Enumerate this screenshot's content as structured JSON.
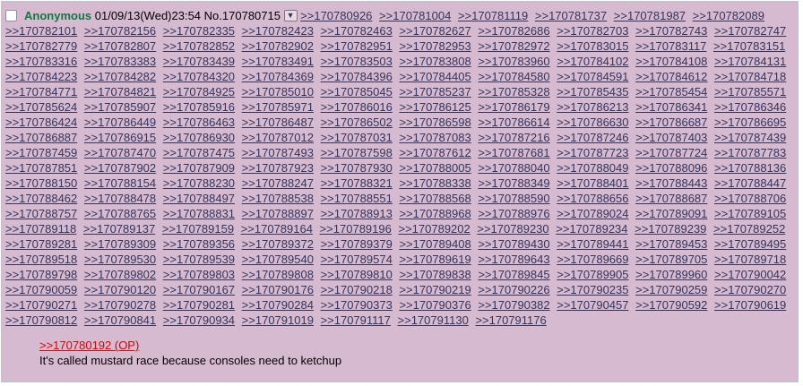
{
  "post": {
    "name": "Anonymous",
    "datetime": "01/09/13(Wed)23:54",
    "number": "No.170780715",
    "menu_glyph": "▼",
    "replies": [
      ">>170780926",
      ">>170781004",
      ">>170781119",
      ">>170781737",
      ">>170781987",
      ">>170782089",
      ">>170782101",
      ">>170782156",
      ">>170782335",
      ">>170782423",
      ">>170782463",
      ">>170782627",
      ">>170782686",
      ">>170782703",
      ">>170782743",
      ">>170782747",
      ">>170782779",
      ">>170782807",
      ">>170782852",
      ">>170782902",
      ">>170782951",
      ">>170782953",
      ">>170782972",
      ">>170783015",
      ">>170783117",
      ">>170783151",
      ">>170783316",
      ">>170783383",
      ">>170783439",
      ">>170783491",
      ">>170783503",
      ">>170783808",
      ">>170783960",
      ">>170784102",
      ">>170784108",
      ">>170784131",
      ">>170784223",
      ">>170784282",
      ">>170784320",
      ">>170784369",
      ">>170784396",
      ">>170784405",
      ">>170784580",
      ">>170784591",
      ">>170784612",
      ">>170784718",
      ">>170784771",
      ">>170784821",
      ">>170784925",
      ">>170785010",
      ">>170785045",
      ">>170785237",
      ">>170785328",
      ">>170785435",
      ">>170785454",
      ">>170785571",
      ">>170785624",
      ">>170785907",
      ">>170785916",
      ">>170785971",
      ">>170786016",
      ">>170786125",
      ">>170786179",
      ">>170786213",
      ">>170786341",
      ">>170786346",
      ">>170786424",
      ">>170786449",
      ">>170786463",
      ">>170786487",
      ">>170786502",
      ">>170786598",
      ">>170786614",
      ">>170786630",
      ">>170786687",
      ">>170786695",
      ">>170786887",
      ">>170786915",
      ">>170786930",
      ">>170787012",
      ">>170787031",
      ">>170787083",
      ">>170787216",
      ">>170787246",
      ">>170787403",
      ">>170787439",
      ">>170787459",
      ">>170787470",
      ">>170787475",
      ">>170787493",
      ">>170787598",
      ">>170787612",
      ">>170787681",
      ">>170787723",
      ">>170787724",
      ">>170787783",
      ">>170787851",
      ">>170787902",
      ">>170787909",
      ">>170787923",
      ">>170787930",
      ">>170788005",
      ">>170788040",
      ">>170788049",
      ">>170788096",
      ">>170788136",
      ">>170788150",
      ">>170788154",
      ">>170788230",
      ">>170788247",
      ">>170788321",
      ">>170788338",
      ">>170788349",
      ">>170788401",
      ">>170788443",
      ">>170788447",
      ">>170788462",
      ">>170788478",
      ">>170788497",
      ">>170788538",
      ">>170788551",
      ">>170788568",
      ">>170788590",
      ">>170788656",
      ">>170788687",
      ">>170788706",
      ">>170788757",
      ">>170788765",
      ">>170788831",
      ">>170788897",
      ">>170788913",
      ">>170788968",
      ">>170788976",
      ">>170789024",
      ">>170789091",
      ">>170789105",
      ">>170789118",
      ">>170789137",
      ">>170789159",
      ">>170789164",
      ">>170789196",
      ">>170789202",
      ">>170789230",
      ">>170789234",
      ">>170789239",
      ">>170789252",
      ">>170789281",
      ">>170789309",
      ">>170789356",
      ">>170789372",
      ">>170789379",
      ">>170789408",
      ">>170789430",
      ">>170789441",
      ">>170789453",
      ">>170789495",
      ">>170789518",
      ">>170789530",
      ">>170789539",
      ">>170789540",
      ">>170789574",
      ">>170789619",
      ">>170789643",
      ">>170789669",
      ">>170789705",
      ">>170789718",
      ">>170789798",
      ">>170789802",
      ">>170789803",
      ">>170789808",
      ">>170789810",
      ">>170789838",
      ">>170789845",
      ">>170789905",
      ">>170789960",
      ">>170790042",
      ">>170790059",
      ">>170790120",
      ">>170790167",
      ">>170790176",
      ">>170790218",
      ">>170790219",
      ">>170790226",
      ">>170790235",
      ">>170790259",
      ">>170790270",
      ">>170790271",
      ">>170790278",
      ">>170790281",
      ">>170790284",
      ">>170790373",
      ">>170790376",
      ">>170790382",
      ">>170790457",
      ">>170790592",
      ">>170790619",
      ">>170790812",
      ">>170790841",
      ">>170790934",
      ">>170791019",
      ">>170791117",
      ">>170791130",
      ">>170791176"
    ],
    "quote_link": ">>170780192 (OP)",
    "message": "It's called mustard race because consoles need to ketchup"
  }
}
